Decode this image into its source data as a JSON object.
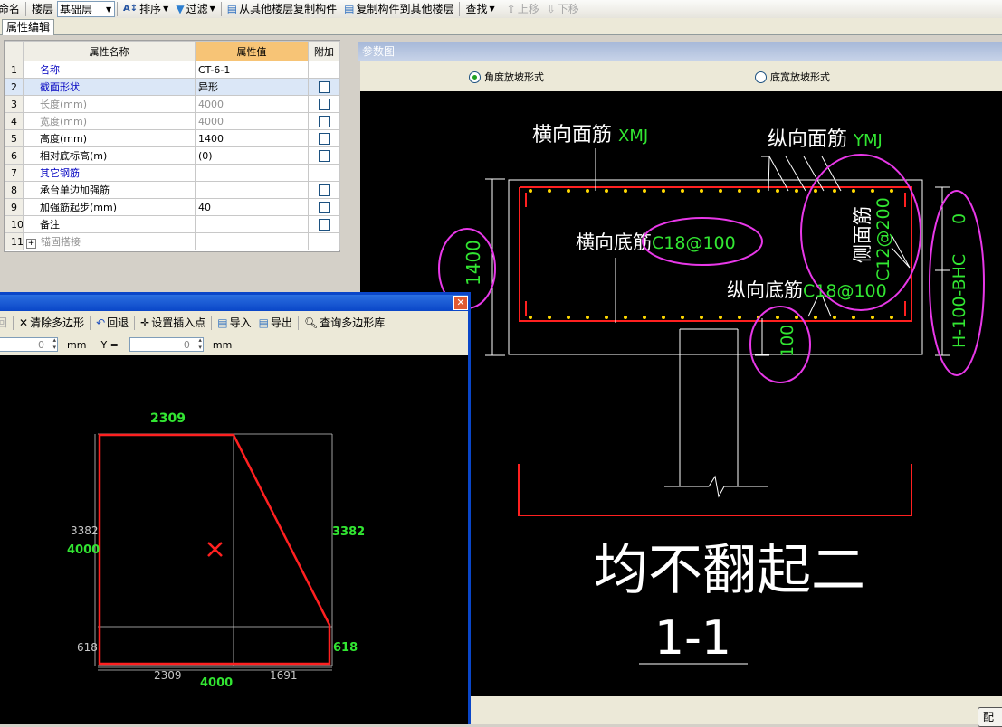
{
  "toolbar": {
    "rename": "重命名",
    "floor_label": "楼层",
    "floor_value": "基础层",
    "sort": "排序",
    "filter": "过滤",
    "copy_from_other": "从其他楼层复制构件",
    "copy_to_other": "复制构件到其他楼层",
    "find": "查找",
    "move_up": "上移",
    "move_down": "下移"
  },
  "tab": {
    "label": "属性编辑"
  },
  "grid": {
    "headers": {
      "name": "属性名称",
      "value": "属性值",
      "extra": "附加"
    },
    "rows": [
      {
        "num": "1",
        "name": "名称",
        "value": "CT-6-1"
      },
      {
        "num": "2",
        "name": "截面形状",
        "value": "异形"
      },
      {
        "num": "3",
        "name": "长度(mm)",
        "value": "4000"
      },
      {
        "num": "4",
        "name": "宽度(mm)",
        "value": "4000"
      },
      {
        "num": "5",
        "name": "高度(mm)",
        "value": "1400"
      },
      {
        "num": "6",
        "name": "相对底标高(m)",
        "value": "(0)"
      },
      {
        "num": "7",
        "name": "其它钢筋",
        "value": ""
      },
      {
        "num": "8",
        "name": "承台单边加强筋",
        "value": ""
      },
      {
        "num": "9",
        "name": "加强筋起步(mm)",
        "value": "40"
      },
      {
        "num": "10",
        "name": "备注",
        "value": ""
      },
      {
        "num": "11",
        "name": "锚固搭接",
        "value": ""
      }
    ]
  },
  "panel": {
    "title": "参数图",
    "radio1": "角度放坡形式",
    "radio2": "底宽放坡形式",
    "button": "配"
  },
  "diagram": {
    "top_x_label": "横向面筋",
    "top_x_code": "XMJ",
    "top_y_label": "纵向面筋",
    "top_y_code": "YMJ",
    "bottom_x_label": "横向底筋",
    "bottom_x_value": "C18@100",
    "bottom_y_label": "纵向底筋",
    "bottom_y_value": "C18@100",
    "side_label": "侧面筋",
    "side_value": "C12@200",
    "height": "1400",
    "cover": "100",
    "dim_top": "0",
    "dim_right": "H-100-BHC",
    "title": "均不翻起二",
    "section": "1-1"
  },
  "editor": {
    "tools": {
      "back": "回",
      "clear": "清除多边形",
      "undo": "回退",
      "set_point": "设置插入点",
      "import": "导入",
      "export": "导出",
      "query": "查询多边形库"
    },
    "x_value": "0",
    "y_label": "Y =",
    "y_value": "0",
    "unit": "mm",
    "dims": {
      "top": "2309",
      "left_total": "4000",
      "left_upper": "3382",
      "left_lower": "618",
      "right_upper": "3382",
      "right_lower": "618",
      "bottom_left": "2309",
      "bottom_right": "1691",
      "bottom_total": "4000"
    }
  }
}
